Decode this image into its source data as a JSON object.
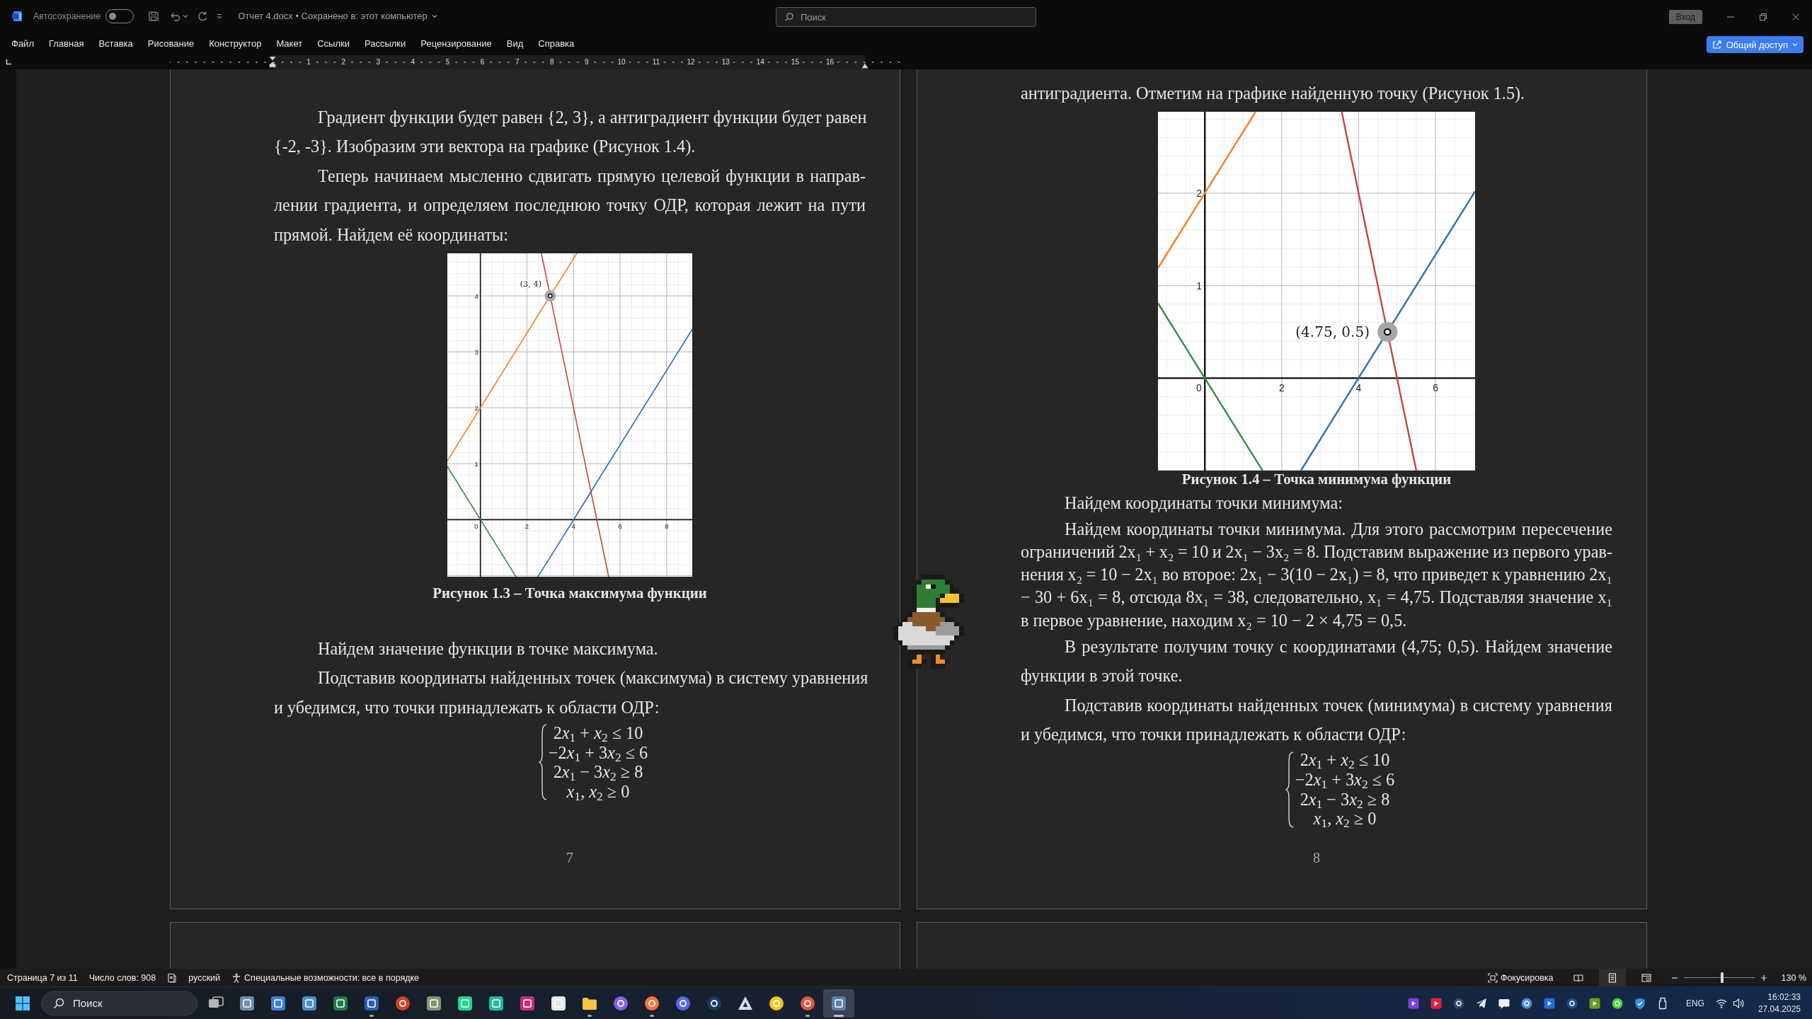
{
  "title_bar": {
    "autosave_label": "Автосохранение",
    "autosave_on": false,
    "document_title": "Отчет 4.docx • Сохранено в: этот компьютер",
    "search": {
      "placeholder": "Поиск"
    },
    "sign_in": "Вход"
  },
  "menu": [
    "Файл",
    "Главная",
    "Вставка",
    "Рисование",
    "Конструктор",
    "Макет",
    "Ссылки",
    "Рассылки",
    "Рецензирование",
    "Вид",
    "Справка"
  ],
  "share_button": "Общий доступ",
  "ruler": {
    "numbers": [
      "1",
      "2",
      "3",
      "4",
      "5",
      "6",
      "7",
      "8",
      "9",
      "10",
      "11",
      "12",
      "13",
      "14",
      "15",
      "16"
    ]
  },
  "pages": [
    {
      "blocks": [
        {
          "kind": "paragraph",
          "text": "Градиент функции будет равен {2, 3}, а антиградиент функции будет равен\n{-2, -3}. Изобразим эти вектора на графике (Рисунок 1.4)."
        },
        {
          "kind": "paragraph",
          "text": "Теперь начинаем мысленно сдвигать прямую целевой функции в направ-\nлении градиента, и определяем последнюю точку ОДР, которая лежит на пути\nпрямой. Найдем её координаты:"
        },
        {
          "kind": "figure",
          "chart_data": {
            "type": "line",
            "grid": true,
            "x": [
              -1.42,
              1.53,
              2.47,
              2.62,
              3,
              4.14,
              5.51,
              9.1
            ],
            "series": [
              {
                "color": "#fa7e19",
                "values": [
                  1.05,
                  3.02,
                  3.65,
                  3.75,
                  4,
                  4.76,
                  null,
                  null
                ]
              },
              {
                "color": "#c74440",
                "values": [
                  null,
                  null,
                  null,
                  4.76,
                  4,
                  1.72,
                  -1.02,
                  null
                ]
              },
              {
                "color": "#2d70b3",
                "values": [
                  null,
                  null,
                  -1.02,
                  -0.92,
                  -0.67,
                  0.09,
                  1.01,
                  3.4
                ]
              },
              {
                "color": "#388c46",
                "values": [
                  0.95,
                  -1.02,
                  null,
                  null,
                  null,
                  null,
                  null,
                  null
                ]
              }
            ],
            "xlim": [
              -1.42,
              9.1
            ],
            "ylim": [
              -1.02,
              4.76
            ],
            "xticks": [
              {
                "value": 0,
                "label": "0"
              },
              {
                "value": 2,
                "label": "2"
              },
              {
                "value": 4,
                "label": "4"
              },
              {
                "value": 6,
                "label": "6"
              },
              {
                "value": 8,
                "label": "8"
              }
            ],
            "yticks": [
              {
                "value": 1,
                "label": "1"
              },
              {
                "value": 2,
                "label": "2"
              },
              {
                "value": 3,
                "label": "3"
              },
              {
                "value": 4,
                "label": "4"
              }
            ],
            "annotations": [
              {
                "x": 3,
                "y": 4,
                "text": "(3, 4)"
              }
            ]
          }
        },
        {
          "kind": "caption",
          "text": "Рисунок 1.3 – Точка максимума функции"
        },
        {
          "kind": "paragraph",
          "text": "Найдем значение функции в точке максимума."
        },
        {
          "kind": "paragraph",
          "text": "Подставив координаты найденных точек (максимума) в систему уравнения\nи убедимся, что точки принадлежать к области ОДР:"
        },
        {
          "kind": "equation",
          "lines": [
            "2x$_{1}$ + x$_{2}$ ≤ 10",
            "−2x$_{1}$ + 3x$_{2}$ ≤ 6",
            "2x$_{1}$ − 3x$_{2}$ ≥ 8",
            "x$_{1}$, x$_{2}$ ≥ 0"
          ]
        }
      ],
      "page_number": "7"
    },
    {
      "blocks": [
        {
          "kind": "continuation",
          "text": "антиградиента. Отметим на графике найденную точку (Рисунок 1.5)."
        },
        {
          "kind": "figure",
          "chart_data": {
            "type": "line",
            "grid": true,
            "x": [
              -1.22,
              1.32,
              1.5,
              2.5,
              3.56,
              4.75,
              5.5,
              7.03
            ],
            "series": [
              {
                "color": "#fa7e19",
                "values": [
                  1.19,
                  2.88,
                  null,
                  null,
                  null,
                  null,
                  null,
                  null
                ]
              },
              {
                "color": "#c74440",
                "values": [
                  null,
                  null,
                  null,
                  null,
                  2.88,
                  0.5,
                  -1,
                  null
                ]
              },
              {
                "color": "#2d70b3",
                "values": [
                  null,
                  null,
                  null,
                  -1,
                  -0.29,
                  0.5,
                  1,
                  2.02
                ]
              },
              {
                "color": "#388c46",
                "values": [
                  0.81,
                  -0.88,
                  -1,
                  null,
                  null,
                  null,
                  null,
                  null
                ]
              }
            ],
            "xlim": [
              -1.22,
              7.03
            ],
            "ylim": [
              -1,
              2.88
            ],
            "xticks": [
              {
                "value": 0,
                "label": "0"
              },
              {
                "value": 2,
                "label": "2"
              },
              {
                "value": 4,
                "label": "4"
              },
              {
                "value": 6,
                "label": "6"
              }
            ],
            "yticks": [
              {
                "value": 1,
                "label": "1"
              },
              {
                "value": 2,
                "label": "2"
              }
            ],
            "annotations": [
              {
                "x": 4.75,
                "y": 0.5,
                "text": "(4.75, 0.5)"
              }
            ]
          }
        },
        {
          "kind": "caption",
          "text": "Рисунок 1.4 – Точка минимума функции"
        },
        {
          "kind": "paragraph",
          "text": "Найдем координаты точки минимума:"
        },
        {
          "kind": "compact",
          "text": "Найдем координаты точки минимума. Для этого рассмотрим пересечение\nограничений 2x₁ + x₂ = 10 и 2x₁ − 3x₂ = 8. Подставим выражение из первого урав-\nнения x₂ = 10 − 2x₁ во второе: 2x₁ − 3(10 − 2x₁) = 8, что приведет к уравнению 2x₁\n− 30 + 6x₁ = 8, отсюда 8x₁ = 38, следовательно, x₁ = 4,75. Подставляя значение x₁\nв первое уравнение, находим x₂ = 10 − 2 × 4,75 = 0,5."
        },
        {
          "kind": "paragraph",
          "text": "В результате получим точку с координатами (4,75; 0,5). Найдем значение\nфункции в этой точке."
        },
        {
          "kind": "paragraph",
          "text": "Подставив координаты найденных точек (минимума) в систему уравнения\nи убедимся, что точки принадлежать к области ОДР:"
        },
        {
          "kind": "equation",
          "lines": [
            "2x$_{1}$ + x$_{2}$ ≤ 10",
            "−2x$_{1}$ + 3x$_{2}$ ≤ 6",
            "2x$_{1}$ − 3x$_{2}$ ≥ 8",
            "x$_{1}$, x$_{2}$ ≥ 0"
          ]
        }
      ],
      "page_number": "8"
    }
  ],
  "status_bar": {
    "page": "Страница 7 из 11",
    "word_count": "Число слов: 908",
    "language": "русский",
    "accessibility": "Специальные возможности: все в порядке",
    "focus": "Фокусировка",
    "views": [
      {
        "kind": "reading",
        "selected": false
      },
      {
        "kind": "print",
        "selected": true
      },
      {
        "kind": "web",
        "selected": false
      }
    ],
    "zoom": {
      "level": 0.54,
      "reading": "130 %"
    }
  },
  "taskbar": {
    "search": {
      "placeholder": "Поиск"
    },
    "apps": [
      {
        "kind": "window",
        "color": "#b5b5b5",
        "running": false,
        "selected": false
      },
      {
        "kind": "tile",
        "color": "#6f8fa6",
        "running": false,
        "selected": false
      },
      {
        "kind": "tile",
        "color": "#3f7fd0",
        "running": false,
        "selected": false
      },
      {
        "kind": "tile",
        "color": "#4a8fc8",
        "running": false,
        "selected": false
      },
      {
        "kind": "tile",
        "color": "#1f7a45",
        "running": false,
        "selected": false
      },
      {
        "kind": "tile",
        "color": "#2b5fb4",
        "running": true,
        "selected": false
      },
      {
        "kind": "circle",
        "color": "#d04423",
        "running": false,
        "selected": false
      },
      {
        "kind": "tile",
        "color": "#7f9a70",
        "running": false,
        "selected": false
      },
      {
        "kind": "tile",
        "color": "#21d789",
        "running": false,
        "selected": false
      },
      {
        "kind": "tile",
        "color": "#1fb8a0",
        "running": false,
        "selected": false
      },
      {
        "kind": "tile",
        "color": "#c2307a",
        "running": false,
        "selected": false
      },
      {
        "kind": "tile",
        "color": "#e8e8e8",
        "running": false,
        "selected": false
      },
      {
        "kind": "folder",
        "color": "#f4c542",
        "running": true,
        "selected": false
      },
      {
        "kind": "circle",
        "color": "#8a5cf5",
        "running": false,
        "selected": false
      },
      {
        "kind": "circle",
        "color": "#ff7139",
        "running": true,
        "selected": false
      },
      {
        "kind": "circle",
        "color": "#5865f2",
        "running": false,
        "selected": false
      },
      {
        "kind": "circle",
        "color": "#1e3a64",
        "running": false,
        "selected": false
      },
      {
        "kind": "triangle",
        "color": "#dcdcf0",
        "running": false,
        "selected": false
      },
      {
        "kind": "circle",
        "color": "#f5c518",
        "running": false,
        "selected": false
      },
      {
        "kind": "circle",
        "color": "#e8553e",
        "running": true,
        "selected": false
      },
      {
        "kind": "tile",
        "color": "#5a7fa8",
        "running": true,
        "selected": true
      }
    ],
    "tray": [
      {
        "kind": "tile",
        "color": "#7b3fe4"
      },
      {
        "kind": "tile",
        "color": "#e8203c"
      },
      {
        "kind": "circle",
        "color": "#3a4a66"
      },
      {
        "kind": "plane",
        "color": "#f0f0f0"
      },
      {
        "kind": "bubble",
        "color": "#f0f0f0"
      },
      {
        "kind": "circle",
        "color": "#4a8fe0"
      },
      {
        "kind": "tile",
        "color": "#1e6fe8"
      },
      {
        "kind": "circle",
        "color": "#1b4f8a"
      },
      {
        "kind": "tile",
        "color": "#6a9a20"
      },
      {
        "kind": "circle",
        "color": "#44d62c"
      },
      {
        "kind": "shield",
        "color": "#2f8fe0"
      },
      {
        "kind": "usb",
        "color": "#e6e6e6"
      }
    ],
    "language": "ENG",
    "time": "16:02:33",
    "date": "27.04.2025"
  }
}
